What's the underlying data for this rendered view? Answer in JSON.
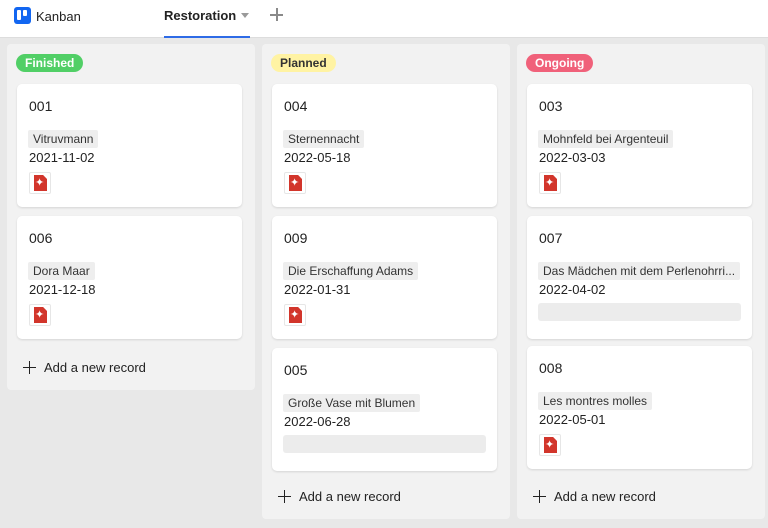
{
  "app": {
    "name": "Kanban",
    "logo_icon": "kanban-board-icon",
    "accent": "#1266f1"
  },
  "view_tabs": [
    {
      "label": "Restoration",
      "active": true
    }
  ],
  "add_record_label": "Add a new record",
  "columns": [
    {
      "status": "Finished",
      "color": "#51cf66",
      "cards": [
        {
          "id": "001",
          "title": "Vitruvmann",
          "date": "2021-11-02",
          "attachment": "pdf-icon"
        },
        {
          "id": "006",
          "title": "Dora Maar",
          "date": "2021-12-18",
          "attachment": "pdf-icon"
        }
      ]
    },
    {
      "status": "Planned",
      "color": "#fff3a3",
      "cards": [
        {
          "id": "004",
          "title": "Sternennacht",
          "date": "2022-05-18",
          "attachment": "pdf-icon"
        },
        {
          "id": "009",
          "title": "Die Erschaffung Adams",
          "date": "2022-01-31",
          "attachment": "pdf-icon"
        },
        {
          "id": "005",
          "title": "Große Vase mit Blumen",
          "date": "2022-06-28",
          "attachment": null
        }
      ]
    },
    {
      "status": "Ongoing",
      "color": "#f0617a",
      "cards": [
        {
          "id": "003",
          "title": "Mohnfeld bei Argenteuil",
          "date": "2022-03-03",
          "attachment": "pdf-icon"
        },
        {
          "id": "007",
          "title": "Das Mädchen mit dem Perlenohrri...",
          "date": "2022-04-02",
          "attachment": null
        },
        {
          "id": "008",
          "title": "Les montres molles",
          "date": "2022-05-01",
          "attachment": "pdf-icon"
        }
      ]
    }
  ]
}
